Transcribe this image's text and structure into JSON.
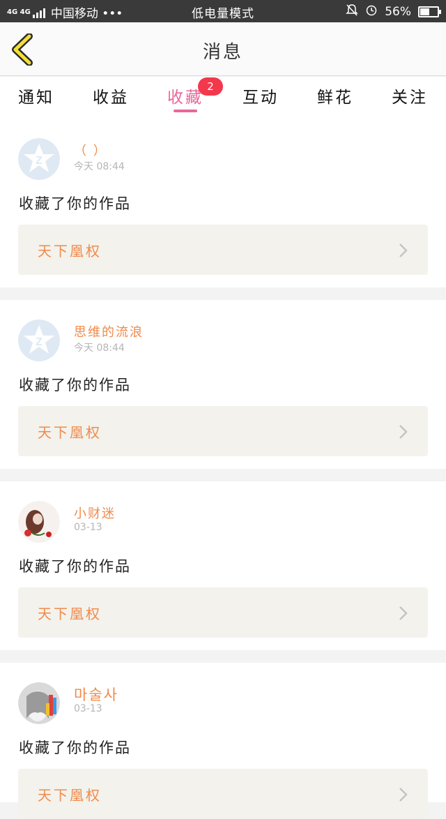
{
  "status_bar": {
    "network": "4G 4G",
    "carrier": "中国移动 •••",
    "mode": "低电量模式",
    "battery": "56%",
    "battery_level": 0.56,
    "icons": [
      "signal-icon",
      "bell-off-icon",
      "alarm-icon",
      "battery-icon"
    ]
  },
  "header": {
    "title": "消息",
    "back_icon": "chevron-left-icon",
    "accent_color": "#f2e03b"
  },
  "tabs": [
    {
      "label": "通知",
      "active": false
    },
    {
      "label": "收益",
      "active": false
    },
    {
      "label": "收藏",
      "active": true,
      "badge": "2"
    },
    {
      "label": "互动",
      "active": false
    },
    {
      "label": "鲜花",
      "active": false
    },
    {
      "label": "关注",
      "active": false
    }
  ],
  "active_color": "#e8679a",
  "items": [
    {
      "username": "（ ）",
      "time": "今天 08:44",
      "action": "收藏了你的作品",
      "work": "天下凰权",
      "avatar": "qq-default-avatar"
    },
    {
      "username": "思维的流浪",
      "time": "今天 08:44",
      "action": "收藏了你的作品",
      "work": "天下凰权",
      "avatar": "qq-default-avatar"
    },
    {
      "username": "小财迷",
      "time": "03-13",
      "action": "收藏了你的作品",
      "work": "天下凰权",
      "avatar": "user-photo-avatar"
    },
    {
      "username": "마술사",
      "time": "03-13",
      "action": "收藏了你的作品",
      "work": "天下凰权",
      "avatar": "user-photo-avatar"
    }
  ]
}
